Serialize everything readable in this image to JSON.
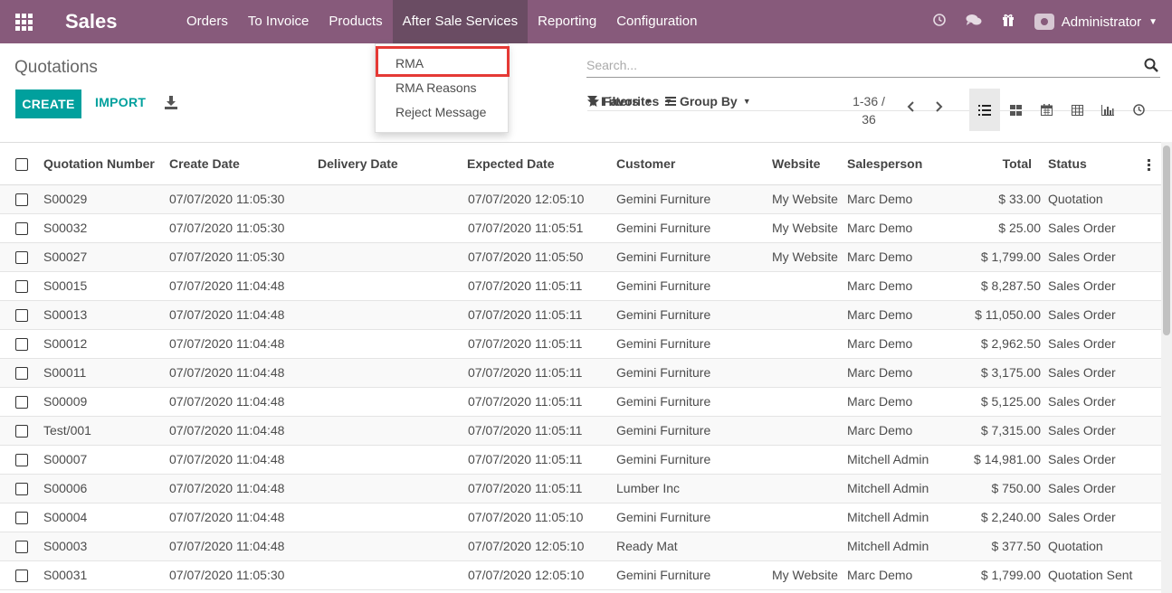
{
  "navbar": {
    "app_title": "Sales",
    "menu": [
      "Orders",
      "To Invoice",
      "Products",
      "After Sale Services",
      "Reporting",
      "Configuration"
    ],
    "active_menu": "After Sale Services",
    "user": "Administrator",
    "bg_color": "#875a7b"
  },
  "dropdown": {
    "items": [
      "RMA",
      "RMA Reasons",
      "Reject Message"
    ],
    "highlighted": "RMA"
  },
  "control": {
    "breadcrumb": "Quotations",
    "create_label": "CREATE",
    "import_label": "IMPORT",
    "search_placeholder": "Search...",
    "filters_label": "Filters",
    "groupby_label": "Group By",
    "favorites_label": "Favorites",
    "pager_range": "1-36 /",
    "pager_total": "36"
  },
  "table": {
    "columns": [
      "Quotation Number",
      "Create Date",
      "Delivery Date",
      "Expected Date",
      "Customer",
      "Website",
      "Salesperson",
      "Total",
      "Status"
    ],
    "rows": [
      [
        "S00029",
        "07/07/2020 11:05:30",
        "",
        "07/07/2020 12:05:10",
        "Gemini Furniture",
        "My Website",
        "Marc Demo",
        "$ 33.00",
        "Quotation"
      ],
      [
        "S00032",
        "07/07/2020 11:05:30",
        "",
        "07/07/2020 11:05:51",
        "Gemini Furniture",
        "My Website",
        "Marc Demo",
        "$ 25.00",
        "Sales Order"
      ],
      [
        "S00027",
        "07/07/2020 11:05:30",
        "",
        "07/07/2020 11:05:50",
        "Gemini Furniture",
        "My Website",
        "Marc Demo",
        "$ 1,799.00",
        "Sales Order"
      ],
      [
        "S00015",
        "07/07/2020 11:04:48",
        "",
        "07/07/2020 11:05:11",
        "Gemini Furniture",
        "",
        "Marc Demo",
        "$ 8,287.50",
        "Sales Order"
      ],
      [
        "S00013",
        "07/07/2020 11:04:48",
        "",
        "07/07/2020 11:05:11",
        "Gemini Furniture",
        "",
        "Marc Demo",
        "$ 11,050.00",
        "Sales Order"
      ],
      [
        "S00012",
        "07/07/2020 11:04:48",
        "",
        "07/07/2020 11:05:11",
        "Gemini Furniture",
        "",
        "Marc Demo",
        "$ 2,962.50",
        "Sales Order"
      ],
      [
        "S00011",
        "07/07/2020 11:04:48",
        "",
        "07/07/2020 11:05:11",
        "Gemini Furniture",
        "",
        "Marc Demo",
        "$ 3,175.00",
        "Sales Order"
      ],
      [
        "S00009",
        "07/07/2020 11:04:48",
        "",
        "07/07/2020 11:05:11",
        "Gemini Furniture",
        "",
        "Marc Demo",
        "$ 5,125.00",
        "Sales Order"
      ],
      [
        "Test/001",
        "07/07/2020 11:04:48",
        "",
        "07/07/2020 11:05:11",
        "Gemini Furniture",
        "",
        "Marc Demo",
        "$ 7,315.00",
        "Sales Order"
      ],
      [
        "S00007",
        "07/07/2020 11:04:48",
        "",
        "07/07/2020 11:05:11",
        "Gemini Furniture",
        "",
        "Mitchell Admin",
        "$ 14,981.00",
        "Sales Order"
      ],
      [
        "S00006",
        "07/07/2020 11:04:48",
        "",
        "07/07/2020 11:05:11",
        "Lumber Inc",
        "",
        "Mitchell Admin",
        "$ 750.00",
        "Sales Order"
      ],
      [
        "S00004",
        "07/07/2020 11:04:48",
        "",
        "07/07/2020 11:05:10",
        "Gemini Furniture",
        "",
        "Mitchell Admin",
        "$ 2,240.00",
        "Sales Order"
      ],
      [
        "S00003",
        "07/07/2020 11:04:48",
        "",
        "07/07/2020 12:05:10",
        "Ready Mat",
        "",
        "Mitchell Admin",
        "$ 377.50",
        "Quotation"
      ],
      [
        "S00031",
        "07/07/2020 11:05:30",
        "",
        "07/07/2020 12:05:10",
        "Gemini Furniture",
        "My Website",
        "Marc Demo",
        "$ 1,799.00",
        "Quotation Sent"
      ]
    ]
  }
}
